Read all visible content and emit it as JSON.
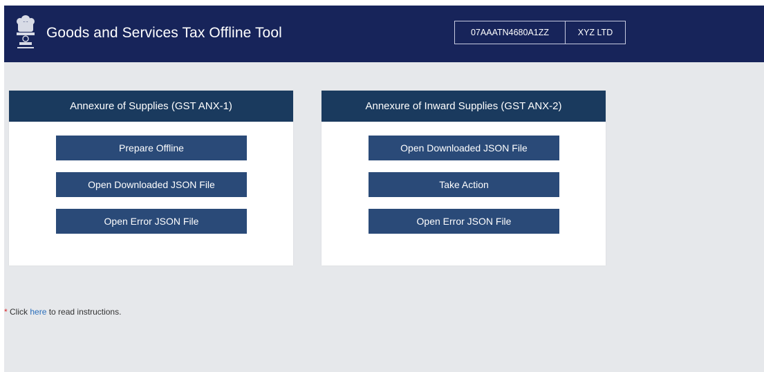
{
  "header": {
    "app_title": "Goods and Services Tax Offline Tool",
    "gstin": "07AAATN4680A1ZZ",
    "company_name": "XYZ LTD",
    "emblem_icon": "national-emblem-icon"
  },
  "cards": [
    {
      "title": "Annexure of Supplies (GST ANX-1)",
      "buttons": [
        "Prepare Offline",
        "Open Downloaded JSON File",
        "Open Error JSON File"
      ]
    },
    {
      "title": "Annexure of Inward Supplies (GST ANX-2)",
      "buttons": [
        "Open Downloaded JSON File",
        "Take Action",
        "Open Error JSON File"
      ]
    }
  ],
  "instructions": {
    "asterisk": "*",
    "prefix": " Click ",
    "link_text": "here",
    "suffix": " to read instructions."
  },
  "colors": {
    "header_bg": "#17245a",
    "card_header_bg": "#1a3a5e",
    "button_bg": "#2a4a78",
    "page_bg": "#e6e8eb",
    "link": "#2a6ebb",
    "asterisk": "#d9272d"
  }
}
